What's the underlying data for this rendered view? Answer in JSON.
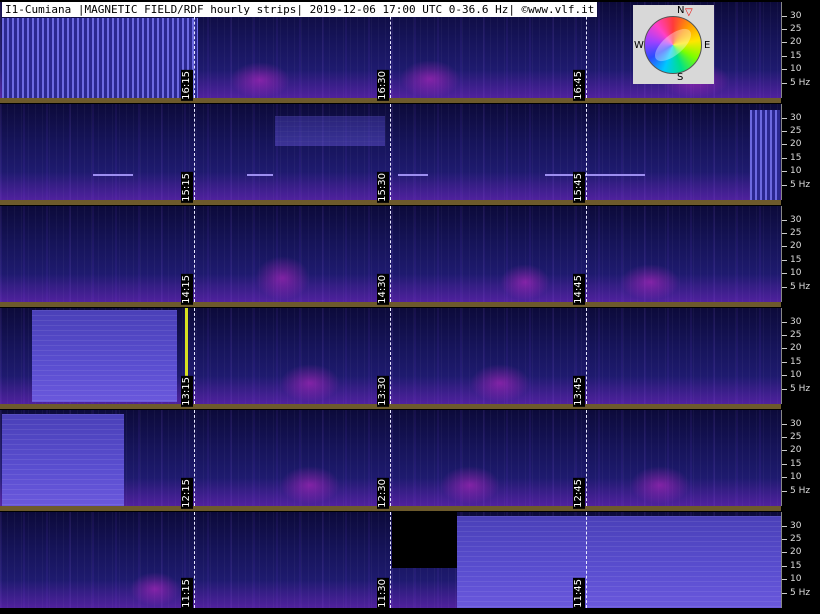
{
  "header": {
    "title": "I1-Cumiana |MAGNETIC FIELD/RDF hourly strips| 2019-12-06 17:00 UTC 0-36.6 Hz| ©www.vlf.it"
  },
  "compass": {
    "n": "N",
    "s": "S",
    "e": "E",
    "w": "W"
  },
  "strips": [
    {
      "times": [
        "16:15",
        "16:30",
        "16:45"
      ]
    },
    {
      "times": [
        "15:15",
        "15:30",
        "15:45"
      ]
    },
    {
      "times": [
        "14:15",
        "14:30",
        "14:45"
      ]
    },
    {
      "times": [
        "13:15",
        "13:30",
        "13:45"
      ]
    },
    {
      "times": [
        "12:15",
        "12:30",
        "12:45"
      ]
    },
    {
      "times": [
        "11:15",
        "11:30",
        "11:45"
      ]
    }
  ],
  "axis": {
    "labels": [
      "30",
      "25",
      "20",
      "15",
      "10",
      "5 Hz"
    ]
  },
  "colors": {
    "background": "#000000",
    "spectrogram": "#1e1a6e",
    "separator": "#6d5a2c",
    "emission": "#c828c8"
  }
}
